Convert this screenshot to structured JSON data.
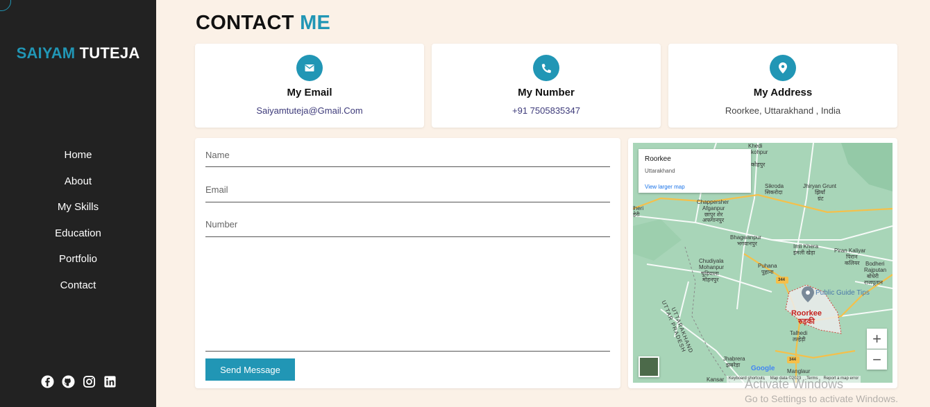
{
  "brand": {
    "first": "SAIYAM",
    "last": "TUTEJA"
  },
  "nav": [
    "Home",
    "About",
    "My Skills",
    "Education",
    "Portfolio",
    "Contact"
  ],
  "socials": [
    "facebook-icon",
    "github-icon",
    "instagram-icon",
    "linkedin-icon"
  ],
  "page": {
    "title_a": "CONTACT",
    "title_b": "ME"
  },
  "cards": [
    {
      "icon": "envelope-icon",
      "title": "My Email",
      "value": "Saiyamtuteja@Gmail.Com"
    },
    {
      "icon": "phone-icon",
      "title": "My Number",
      "value": "+91 7505835347"
    },
    {
      "icon": "location-pin-icon",
      "title": "My Address",
      "value": "Roorkee, Uttarakhand , India"
    }
  ],
  "form": {
    "name_placeholder": "Name",
    "email_placeholder": "Email",
    "number_placeholder": "Number",
    "send_label": "Send Message"
  },
  "map": {
    "info_title": "Roorkee",
    "info_subtitle": "Uttarakhand",
    "info_link": "View larger map",
    "zoom_in": "+",
    "zoom_out": "−",
    "city": "Roorkee",
    "city_hi": "रुड़की",
    "poi": "Public Guide Tips",
    "google": "Google",
    "footer": [
      "Keyboard shortcuts",
      "Map data ©2023",
      "Terms",
      "Report a map error"
    ],
    "labels": {
      "khedi": "Khedi",
      "kohpur": "kohpur",
      "kohpur_hi": "कोहपुर",
      "sikroda": "Sikroda",
      "sikroda_hi": "सिकरोदा",
      "jhiryan": "Jhiryan Grunt",
      "jhiryan_hi": "झिर्यां",
      "jhiryan_hi2": "ग्रंट",
      "chappershe": "Chappersher",
      "afganpur": "Afganpur",
      "afganpur_hi1": "छापुर शेर",
      "afganpur_hi2": "अफगानपुर",
      "lheri": "lheri",
      "lheri_hi": "हेरी",
      "bhagwanpur": "Bhagwanpur",
      "bhagwanpur_hi": "भगवानपुर",
      "imlikhera": "Imli Khera",
      "imlikhera_hi": "इमली खेड़ा",
      "pirankaliyar": "Piran Kaliyar",
      "pirankaliyar_hi1": "पिरान",
      "pirankaliyar_hi2": "कलियर",
      "chudiyala": "Chudiyala",
      "mohanpur": "Mohanpur",
      "chudiyala_hi1": "चुड़ियाला",
      "chudiyala_hi2": "मोहनपुर",
      "puhana": "Puhana",
      "puhana_hi": "पुहाना",
      "bodheri": "Bodheri",
      "rajputan": "Rajputan",
      "bodheri_hi1": "बोधेरी",
      "bodheri_hi2": "राजपूतान",
      "uttarakhand": "UTTARAKHAND",
      "uttarpradesh": "UTTAR PRADESH",
      "talhedi": "Talhedi",
      "talhedi_hi": "तल्हेड़ी",
      "jhabrera": "Jhabrera",
      "jhabrera_hi": "झबरेड़ा",
      "manglaur": "Manglaur",
      "kansar": "Kansar",
      "r344a": "344",
      "r344b": "344"
    }
  },
  "watermark": {
    "line1": "Activate Windows",
    "line2": "Go to Settings to activate Windows."
  }
}
